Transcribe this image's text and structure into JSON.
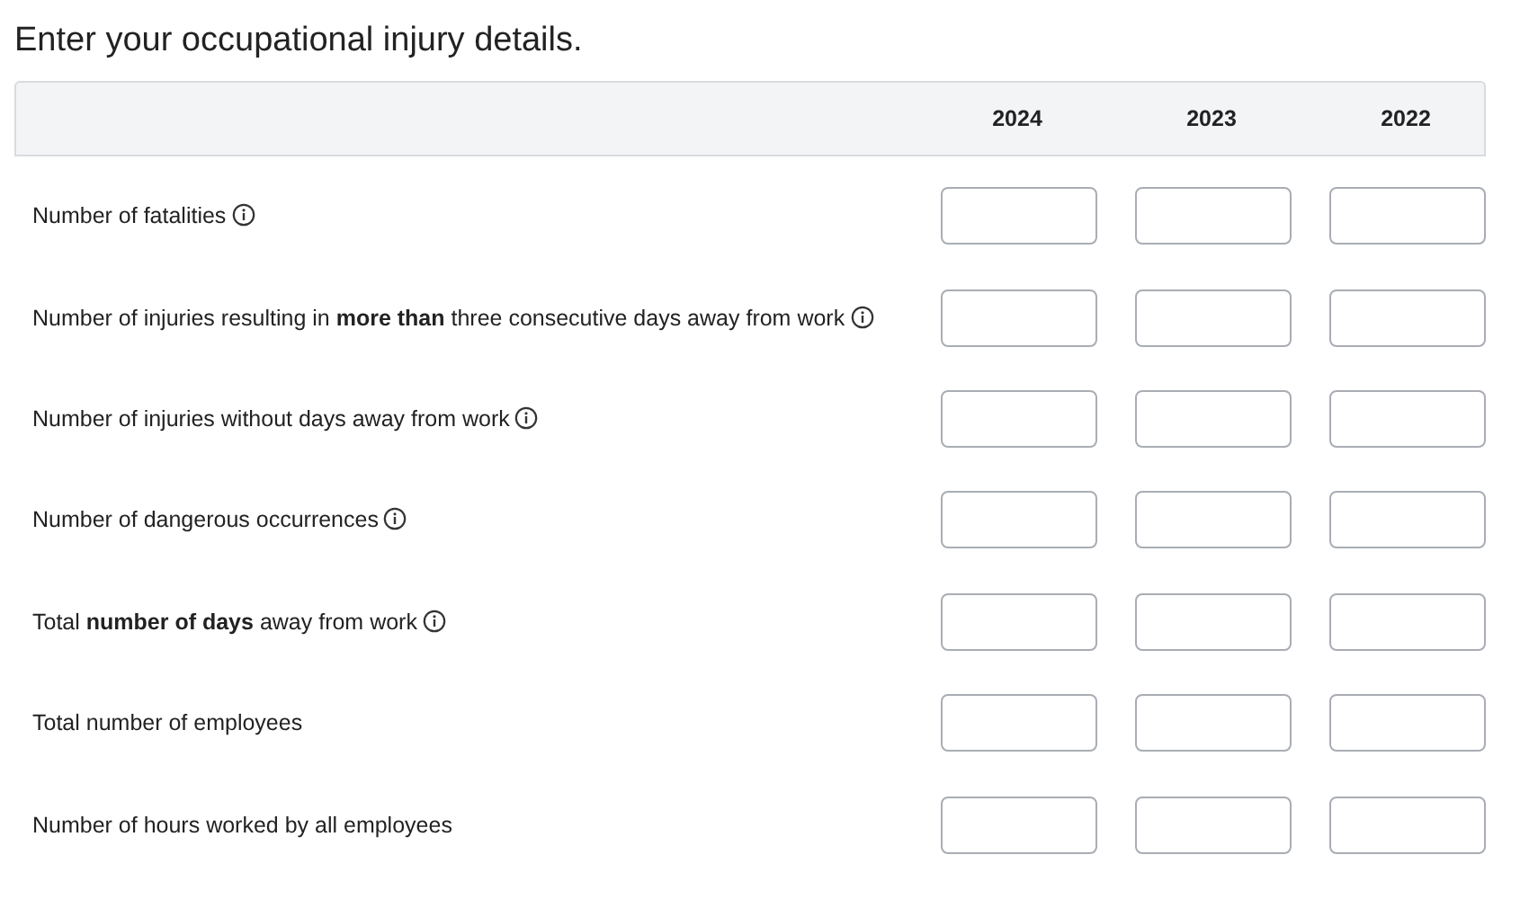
{
  "heading": "Enter your occupational injury details.",
  "columns": [
    "2024",
    "2023",
    "2022"
  ],
  "rows": [
    {
      "label": "Number of fatalities",
      "info": true
    },
    {
      "label": "Number of injuries resulting in **more than** three consecutive days away from work",
      "info": true
    },
    {
      "label": "Number of injuries without days away from work",
      "info": true
    },
    {
      "label": "Number of dangerous occurrences",
      "info": true
    },
    {
      "label": "Total **number of days** away from work",
      "info": true
    },
    {
      "label": "Total number of employees",
      "info": false
    },
    {
      "label": "Number of hours worked by all employees",
      "info": false
    }
  ]
}
